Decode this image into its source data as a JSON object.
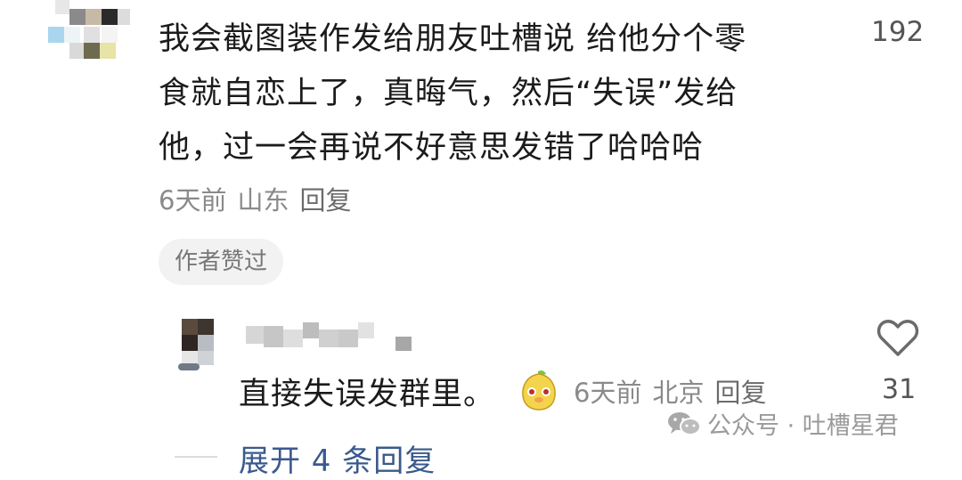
{
  "comment": {
    "text_line1": "我会截图装作发给朋友吐槽说 给他分个零",
    "text_line2": "食就自恋上了，真晦气，然后“失误”发给",
    "text_line3": "他，过一会再说不好意思发错了哈哈哈",
    "time": "6天前",
    "location": "山东",
    "reply_label": "回复",
    "like_count": "192",
    "author_badge": "作者赞过"
  },
  "reply": {
    "text": "直接失误发群里。",
    "sticker_icon": "pear-face-sticker-icon",
    "time": "6天前",
    "location": "北京",
    "reply_label": "回复",
    "like_count": "31",
    "like_icon": "heart-outline-icon"
  },
  "expand_label": "展开 4 条回复",
  "watermark": {
    "icon": "wechat-icon",
    "text": "公众号 · 吐槽星君"
  }
}
